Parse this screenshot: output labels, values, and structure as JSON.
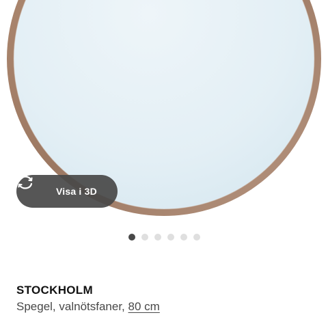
{
  "product_image": {
    "alt": "STOCKHOLM Spegel, valnötsfaner, 80 cm"
  },
  "view_3d": {
    "label": "Visa i 3D",
    "icon": "rotate-3d-icon"
  },
  "carousel": {
    "total": 6,
    "active_index": 0
  },
  "product": {
    "name": "STOCKHOLM",
    "description_prefix": "Spegel, valnötsfaner,",
    "size_link": "80 cm"
  },
  "colors": {
    "frame": "#a9836b",
    "glass": "#e6f1f6",
    "button_bg": "#484848",
    "dot_active": "#484848",
    "dot_inactive": "#dfdfdf"
  }
}
